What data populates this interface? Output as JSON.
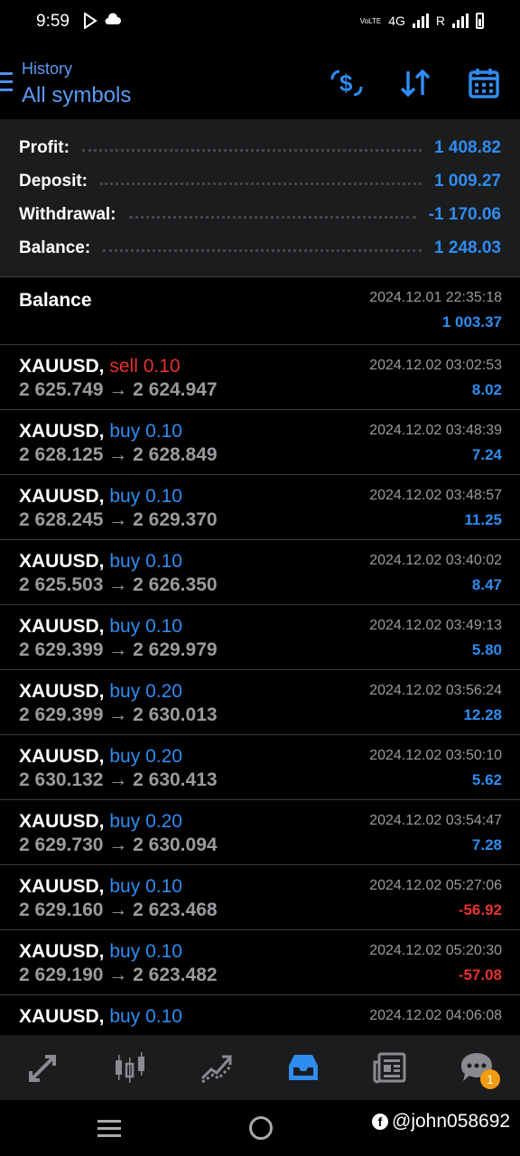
{
  "status_bar": {
    "time": "9:59",
    "network": "4G",
    "roaming": "R",
    "volte": "VoLTE"
  },
  "header": {
    "subtitle": "History",
    "title": "All symbols"
  },
  "icons": {
    "menu": "menu-icon",
    "currency": "dollar-exchange-icon",
    "sort": "sort-icon",
    "calendar": "calendar-icon"
  },
  "summary": [
    {
      "label": "Profit:",
      "value": "1 408.82"
    },
    {
      "label": "Deposit:",
      "value": "1 009.27"
    },
    {
      "label": "Withdrawal:",
      "value": "-1 170.06"
    },
    {
      "label": "Balance:",
      "value": "1 248.03"
    }
  ],
  "balance_entry": {
    "label": "Balance",
    "datetime": "2024.12.01 22:35:18",
    "amount": "1 003.37"
  },
  "trades": [
    {
      "symbol": "XAUUSD,",
      "side": "sell",
      "volume": "0.10",
      "open": "2 625.749",
      "close": "2 624.947",
      "datetime": "2024.12.02 03:02:53",
      "profit": "8.02",
      "profit_sign": "pos"
    },
    {
      "symbol": "XAUUSD,",
      "side": "buy",
      "volume": "0.10",
      "open": "2 628.125",
      "close": "2 628.849",
      "datetime": "2024.12.02 03:48:39",
      "profit": "7.24",
      "profit_sign": "pos"
    },
    {
      "symbol": "XAUUSD,",
      "side": "buy",
      "volume": "0.10",
      "open": "2 628.245",
      "close": "2 629.370",
      "datetime": "2024.12.02 03:48:57",
      "profit": "11.25",
      "profit_sign": "pos"
    },
    {
      "symbol": "XAUUSD,",
      "side": "buy",
      "volume": "0.10",
      "open": "2 625.503",
      "close": "2 626.350",
      "datetime": "2024.12.02 03:40:02",
      "profit": "8.47",
      "profit_sign": "pos"
    },
    {
      "symbol": "XAUUSD,",
      "side": "buy",
      "volume": "0.10",
      "open": "2 629.399",
      "close": "2 629.979",
      "datetime": "2024.12.02 03:49:13",
      "profit": "5.80",
      "profit_sign": "pos"
    },
    {
      "symbol": "XAUUSD,",
      "side": "buy",
      "volume": "0.20",
      "open": "2 629.399",
      "close": "2 630.013",
      "datetime": "2024.12.02 03:56:24",
      "profit": "12.28",
      "profit_sign": "pos"
    },
    {
      "symbol": "XAUUSD,",
      "side": "buy",
      "volume": "0.20",
      "open": "2 630.132",
      "close": "2 630.413",
      "datetime": "2024.12.02 03:50:10",
      "profit": "5.62",
      "profit_sign": "pos"
    },
    {
      "symbol": "XAUUSD,",
      "side": "buy",
      "volume": "0.20",
      "open": "2 629.730",
      "close": "2 630.094",
      "datetime": "2024.12.02 03:54:47",
      "profit": "7.28",
      "profit_sign": "pos"
    },
    {
      "symbol": "XAUUSD,",
      "side": "buy",
      "volume": "0.10",
      "open": "2 629.160",
      "close": "2 623.468",
      "datetime": "2024.12.02 05:27:06",
      "profit": "-56.92",
      "profit_sign": "neg"
    },
    {
      "symbol": "XAUUSD,",
      "side": "buy",
      "volume": "0.10",
      "open": "2 629.190",
      "close": "2 623.482",
      "datetime": "2024.12.02 05:20:30",
      "profit": "-57.08",
      "profit_sign": "neg"
    },
    {
      "symbol": "XAUUSD,",
      "side": "buy",
      "volume": "0.10",
      "open": "",
      "close": "",
      "datetime": "2024.12.02 04:06:08",
      "profit": "",
      "profit_sign": "pos"
    }
  ],
  "arrow": "→",
  "bottom_nav": [
    {
      "name": "quotes-icon",
      "active": false
    },
    {
      "name": "chart-candles-icon",
      "active": false
    },
    {
      "name": "trade-icon",
      "active": false
    },
    {
      "name": "history-inbox-icon",
      "active": true
    },
    {
      "name": "news-icon",
      "active": false
    },
    {
      "name": "messages-icon",
      "active": false,
      "badge": "1"
    }
  ],
  "colors": {
    "accent": "#2f8cf0",
    "loss": "#e5322d",
    "panel": "#1b1c1e",
    "badge": "#f39c12"
  },
  "watermark": "@john058692"
}
